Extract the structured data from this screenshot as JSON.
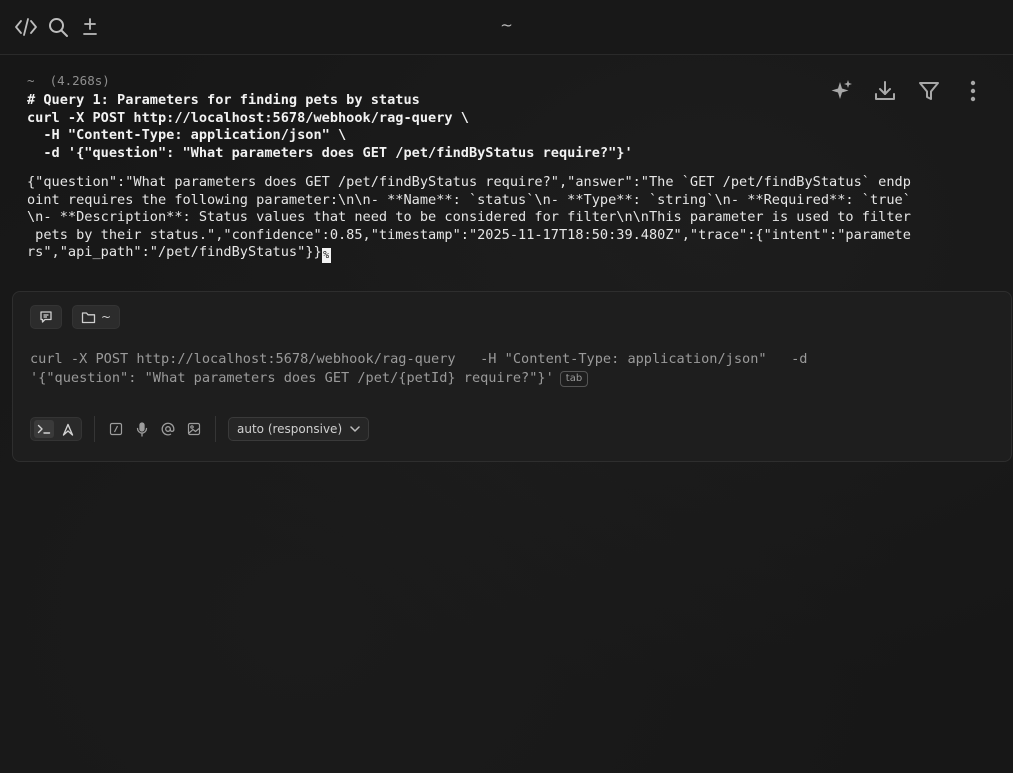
{
  "titlebar": {
    "title": "~",
    "icons": [
      "code-icon",
      "search-icon",
      "plus-minus-icon"
    ]
  },
  "block": {
    "meta": "~  (4.268s)",
    "command_lines": [
      "# Query 1: Parameters for finding pets by status",
      "curl -X POST http://localhost:5678/webhook/rag-query \\",
      "  -H \"Content-Type: application/json\" \\",
      "  -d '{\"question\": \"What parameters does GET /pet/findByStatus require?\"}'"
    ],
    "output_lines": [
      "{\"question\":\"What parameters does GET /pet/findByStatus require?\",\"answer\":\"The `GET /pet/findByStatus` endp",
      "oint requires the following parameter:\\n\\n- **Name**: `status`\\n- **Type**: `string`\\n- **Required**: `true`",
      "\\n- **Description**: Status values that need to be considered for filter\\n\\nThis parameter is used to filter",
      " pets by their status.\",\"confidence\":0.85,\"timestamp\":\"2025-11-17T18:50:39.480Z\",\"trace\":{\"intent\":\"paramete",
      "rs\",\"api_path\":\"/pet/findByStatus\"}}"
    ],
    "cursor_char": "%",
    "actions": [
      "sparkle-icon",
      "download-icon",
      "filter-icon",
      "more-vertical-icon"
    ]
  },
  "input": {
    "dir_chip_label": "~",
    "text_lines": [
      "curl -X POST http://localhost:5678/webhook/rag-query   -H \"Content-Type: application/json\"   -d",
      "'{\"question\": \"What parameters does GET /pet/{petId} require?\"}'"
    ],
    "tab_hint": "tab",
    "model_select": "auto (responsive)"
  }
}
